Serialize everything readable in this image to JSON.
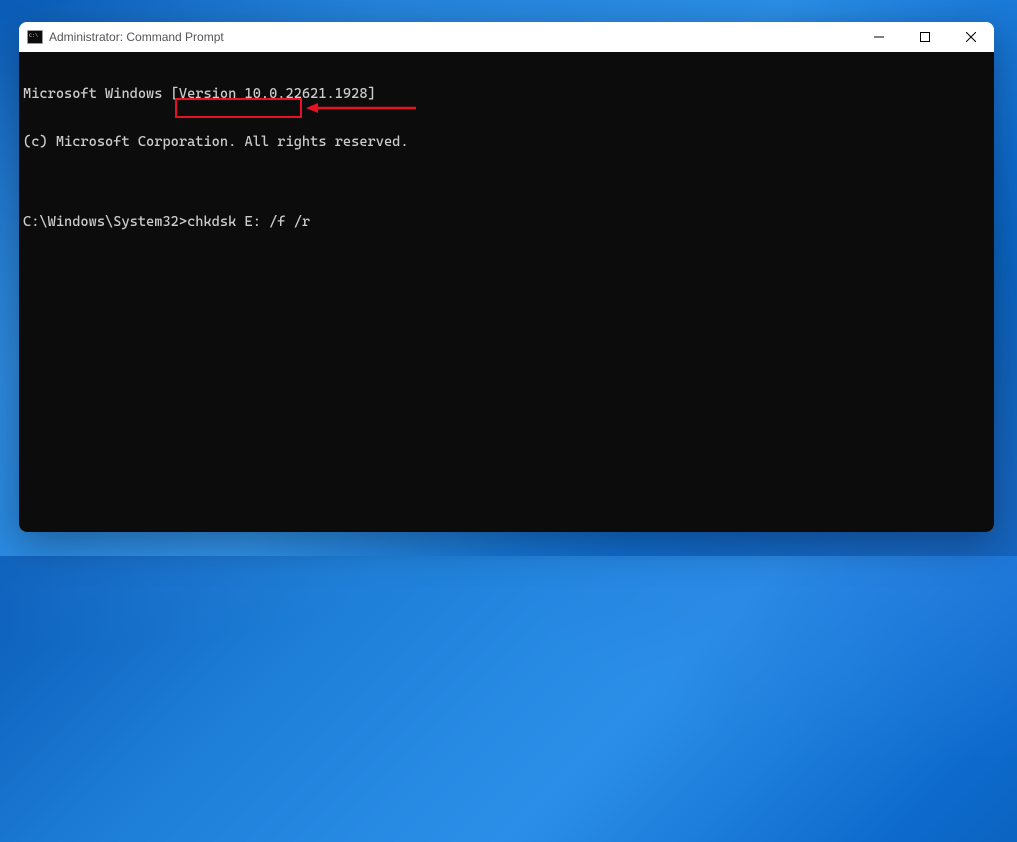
{
  "window": {
    "title": "Administrator: Command Prompt"
  },
  "terminal": {
    "line1": "Microsoft Windows [Version 10.0.22621.1928]",
    "line2": "(c) Microsoft Corporation. All rights reserved.",
    "blank": "",
    "prompt": "C:\\Windows\\System32>",
    "command": "chkdsk E: /f /r"
  },
  "annotation": {
    "highlight_target": "command",
    "arrow_color": "#e81123"
  }
}
